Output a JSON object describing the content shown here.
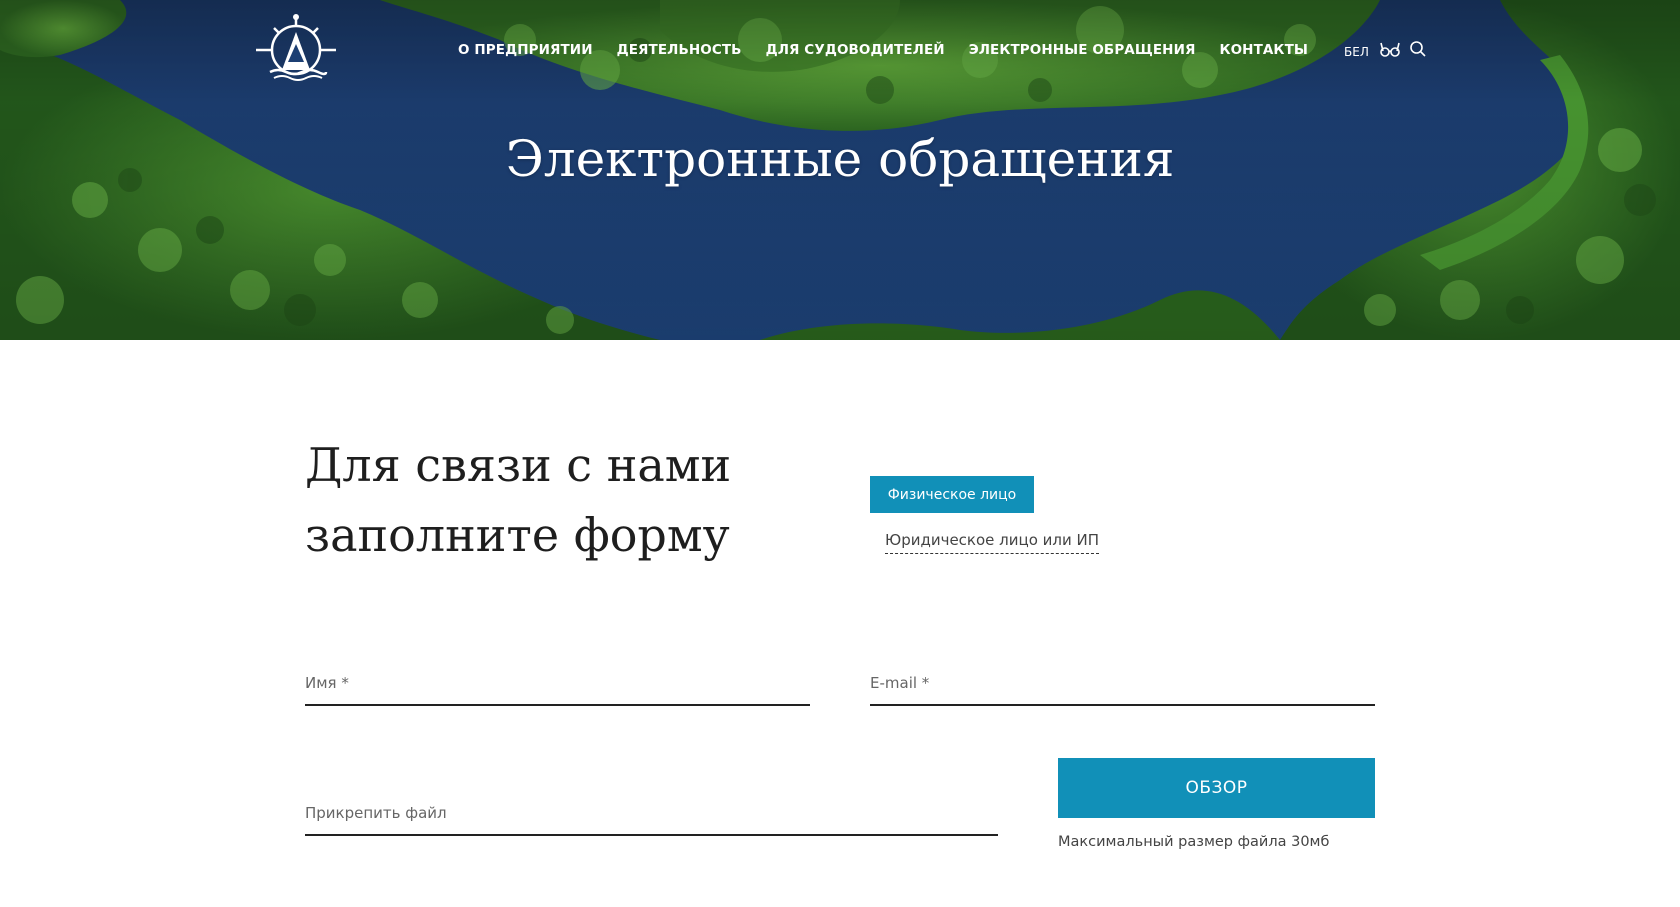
{
  "header": {
    "nav": [
      {
        "label": "О ПРЕДПРИЯТИИ"
      },
      {
        "label": "ДЕЯТЕЛЬНОСТЬ"
      },
      {
        "label": "ДЛЯ СУДОВОДИТЕЛЕЙ"
      },
      {
        "label": "ЭЛЕКТРОННЫЕ ОБРАЩЕНИЯ"
      },
      {
        "label": "КОНТАКТЫ"
      }
    ],
    "language": "БЕЛ",
    "icons": [
      "ship-wheel-logo",
      "glasses-icon",
      "search-icon"
    ]
  },
  "hero": {
    "title": "Электронные обращения"
  },
  "form": {
    "heading": "Для связи с нами заполните форму",
    "tabs": [
      {
        "label": "Физическое лицо",
        "active": true
      },
      {
        "label": "Юридическое лицо или ИП",
        "active": false
      }
    ],
    "name_label": "Имя *",
    "email_label": "E-mail *",
    "file_label": "Прикрепить файл",
    "browse_label": "ОБЗОР",
    "file_note": "Максимальный размер файла 30мб"
  },
  "colors": {
    "accent": "#1190b8",
    "water": "#1c3f73",
    "forest": "#3f8a2c",
    "text": "#1e1e1e"
  }
}
